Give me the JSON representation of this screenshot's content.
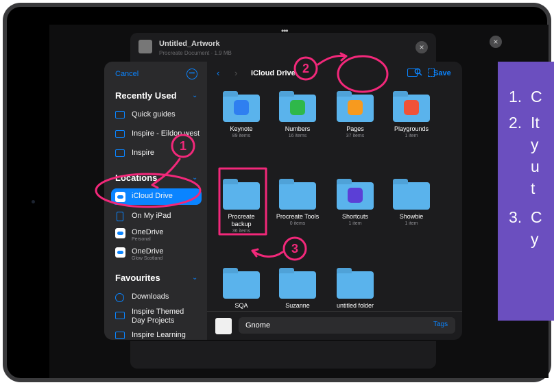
{
  "document": {
    "title": "Untitled_Artwork",
    "subtitle": "Procreate Document · 1.9 MB"
  },
  "sidebar": {
    "cancel": "Cancel",
    "recent_header": "Recently Used",
    "recent": [
      "Quick guides",
      "Inspire - Eildon west",
      "Inspire"
    ],
    "locations_header": "Locations",
    "locations": [
      {
        "label": "iCloud Drive",
        "sub": ""
      },
      {
        "label": "On My iPad",
        "sub": ""
      },
      {
        "label": "OneDrive",
        "sub": "Personal"
      },
      {
        "label": "OneDrive",
        "sub": "Glow Scotland"
      }
    ],
    "favourites_header": "Favourites",
    "favourites": [
      "Downloads",
      "Inspire Themed Day Projects",
      "Inspire Learning"
    ]
  },
  "nav": {
    "title": "iCloud Drive",
    "save": "Save"
  },
  "folders": [
    {
      "name": "Keynote",
      "count": "89 items",
      "app_color": "#2f7ff0"
    },
    {
      "name": "Numbers",
      "count": "16 items",
      "app_color": "#2fb84a"
    },
    {
      "name": "Pages",
      "count": "37 items",
      "app_color": "#f79a1e"
    },
    {
      "name": "Playgrounds",
      "count": "1 item",
      "app_color": "#f05238"
    },
    {
      "name": "Procreate backup",
      "count": "36 items"
    },
    {
      "name": "Procreate Tools",
      "count": "0 items"
    },
    {
      "name": "Shortcuts",
      "count": "1 item",
      "app_color": "#5b3fd6"
    },
    {
      "name": "Showbie",
      "count": "1 item"
    },
    {
      "name": "SQA",
      "count": ""
    },
    {
      "name": "Suzanne",
      "count": ""
    },
    {
      "name": "untitled folder",
      "count": ""
    }
  ],
  "filename": "Gnome",
  "tags": "Tags",
  "annotations": [
    "1",
    "2",
    "3"
  ],
  "instructions": [
    "1.",
    "C",
    "2.",
    "It",
    "y",
    "u",
    "t",
    "3.",
    "C",
    "y"
  ]
}
